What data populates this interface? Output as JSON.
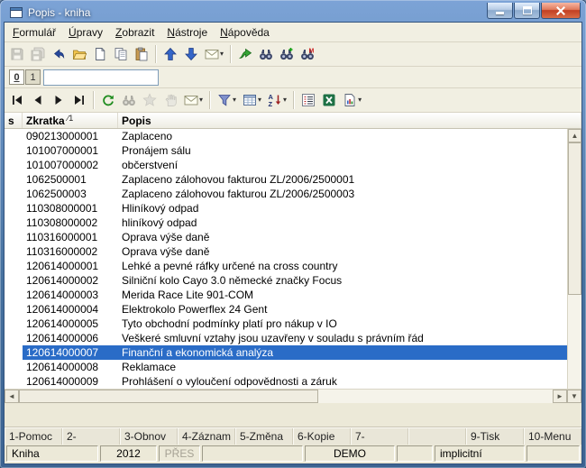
{
  "window": {
    "title": "Popis - kniha"
  },
  "menu": {
    "items": [
      "Formulář",
      "Úpravy",
      "Zobrazit",
      "Nástroje",
      "Nápověda"
    ]
  },
  "icons": {
    "dropdown_caret": "▾"
  },
  "scrollbar": {
    "up": "▲",
    "down": "▼",
    "left": "◄",
    "right": "►"
  },
  "toolbar_main": {
    "items": [
      {
        "name": "save",
        "symbol": "floppy",
        "disabled": true
      },
      {
        "name": "save-all",
        "symbol": "floppy-multi",
        "disabled": true
      },
      {
        "name": "undo",
        "symbol": "undo"
      },
      {
        "name": "open",
        "symbol": "folder"
      },
      {
        "name": "new-record",
        "symbol": "doc"
      },
      {
        "name": "copy",
        "symbol": "copy"
      },
      {
        "name": "paste",
        "symbol": "paste"
      },
      {
        "sep": true
      },
      {
        "name": "move-up",
        "symbol": "arrow-up"
      },
      {
        "name": "move-down",
        "symbol": "arrow-down"
      },
      {
        "name": "send-mail",
        "symbol": "mail",
        "caret": true
      },
      {
        "sep": true
      },
      {
        "name": "export",
        "symbol": "export"
      },
      {
        "name": "find",
        "symbol": "binoc"
      },
      {
        "name": "find-next",
        "symbol": "binoc-plus"
      },
      {
        "name": "find-m",
        "symbol": "binoc-m"
      }
    ]
  },
  "record_tabs": {
    "tabs": [
      "0",
      "1"
    ],
    "active_index": 0,
    "search_value": ""
  },
  "toolbar_nav": {
    "items": [
      {
        "name": "go-first",
        "symbol": "nav-first"
      },
      {
        "name": "go-previous",
        "symbol": "nav-prev"
      },
      {
        "name": "go-next",
        "symbol": "nav-next"
      },
      {
        "name": "go-last",
        "symbol": "nav-last"
      },
      {
        "sep": true
      },
      {
        "name": "refresh",
        "symbol": "refresh"
      },
      {
        "name": "find",
        "symbol": "binoc",
        "disabled": true
      },
      {
        "name": "favorites",
        "symbol": "star",
        "disabled": true
      },
      {
        "name": "grab",
        "symbol": "hand",
        "disabled": true
      },
      {
        "name": "send-mail",
        "symbol": "mail",
        "caret": true
      },
      {
        "sep": true
      },
      {
        "name": "filter",
        "symbol": "funnel",
        "caret": true
      },
      {
        "name": "columns",
        "symbol": "grid",
        "caret": true
      },
      {
        "name": "sort",
        "symbol": "sort-az",
        "caret": true
      },
      {
        "sep": true
      },
      {
        "name": "totals",
        "symbol": "list"
      },
      {
        "name": "export-excel",
        "symbol": "excel"
      },
      {
        "name": "print-report",
        "symbol": "report",
        "caret": true
      }
    ]
  },
  "table": {
    "header": {
      "s": "s",
      "zkratka": "Zkratka",
      "sort_indicator": "∕1",
      "popis": "Popis"
    },
    "selected_index": 15,
    "rows": [
      {
        "zkratka": "090213000001",
        "popis": "Zaplaceno"
      },
      {
        "zkratka": "101007000001",
        "popis": "Pronájem sálu"
      },
      {
        "zkratka": "101007000002",
        "popis": "občerstvení"
      },
      {
        "zkratka": "1062500001",
        "popis": "Zaplaceno zálohovou fakturou ZL/2006/2500001"
      },
      {
        "zkratka": "1062500003",
        "popis": "Zaplaceno zálohovou fakturou ZL/2006/2500003"
      },
      {
        "zkratka": "110308000001",
        "popis": "Hliníkový odpad"
      },
      {
        "zkratka": "110308000002",
        "popis": "hliníkový odpad"
      },
      {
        "zkratka": "110316000001",
        "popis": "Oprava výše daně"
      },
      {
        "zkratka": "110316000002",
        "popis": "Oprava výše daně"
      },
      {
        "zkratka": "120614000001",
        "popis": "Lehké a pevné ráfky určené na cross country"
      },
      {
        "zkratka": "120614000002",
        "popis": "Silniční kolo Cayo 3.0 německé značky Focus"
      },
      {
        "zkratka": "120614000003",
        "popis": "Merida Race Lite 901-COM"
      },
      {
        "zkratka": "120614000004",
        "popis": "Elektrokolo Powerflex 24 Gent"
      },
      {
        "zkratka": "120614000005",
        "popis": "Tyto obchodní podmínky platí pro nákup v IO"
      },
      {
        "zkratka": "120614000006",
        "popis": "Veškeré smluvní vztahy jsou uzavřeny v souladu s právním řád"
      },
      {
        "zkratka": "120614000007",
        "popis": "Finanční a ekonomická analýza"
      },
      {
        "zkratka": "120614000008",
        "popis": "Reklamace"
      },
      {
        "zkratka": "120614000009",
        "popis": "Prohlášení o vyloučení odpovědnosti a záruk"
      }
    ]
  },
  "fkeys": {
    "items": [
      "1-Pomoc",
      "2-",
      "3-Obnov",
      "4-Záznam",
      "5-Změna",
      "6-Kopie",
      "7-",
      "",
      "9-Tisk",
      "10-Menu"
    ]
  },
  "statusbar": {
    "panels": [
      {
        "label": "Kniha",
        "width": 102
      },
      {
        "label": "2012",
        "width": 63,
        "align": "center"
      },
      {
        "label": "PŘES",
        "width": 46,
        "align": "center",
        "muted": true
      },
      {
        "label": "",
        "width": 112
      },
      {
        "label": "DEMO",
        "width": 100,
        "align": "center"
      },
      {
        "label": "",
        "width": 40
      },
      {
        "label": "implicitní",
        "width": 100
      },
      {
        "label": ""
      }
    ]
  },
  "colors": {
    "selection": "#2a6cc7",
    "titlebar": "#4d7fb8",
    "close_button": "#c23e22"
  }
}
